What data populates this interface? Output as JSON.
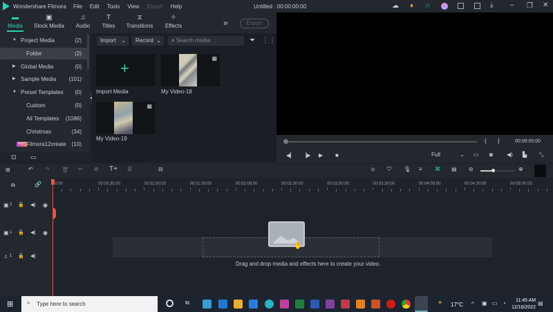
{
  "app": {
    "title": "Wondershare Filmora",
    "doc_title": "Untitled : 00:00:00:00",
    "menu": [
      "File",
      "Edit",
      "Tools",
      "View",
      "Export",
      "Help"
    ]
  },
  "tabs": [
    {
      "label": "Media",
      "icon": "folder-icon"
    },
    {
      "label": "Stock Media",
      "icon": "image-icon"
    },
    {
      "label": "Audio",
      "icon": "music-icon"
    },
    {
      "label": "Titles",
      "icon": "text-icon"
    },
    {
      "label": "Transitions",
      "icon": "transition-icon"
    },
    {
      "label": "Effects",
      "icon": "effects-icon"
    }
  ],
  "export_label": "Export",
  "sidebar": [
    {
      "label": "Project Media",
      "count": "(2)",
      "arrow": "▼"
    },
    {
      "label": "Folder",
      "count": "(2)",
      "arrow": ""
    },
    {
      "label": "Global Media",
      "count": "(0)",
      "arrow": "▶"
    },
    {
      "label": "Sample Media",
      "count": "(101)",
      "arrow": "▶"
    },
    {
      "label": "Preset Templates",
      "count": "(0)",
      "arrow": "▼"
    },
    {
      "label": "Custom",
      "count": "(0)",
      "arrow": ""
    },
    {
      "label": "All Templates",
      "count": "(1086)",
      "arrow": ""
    },
    {
      "label": "Christmas",
      "count": "(34)",
      "arrow": ""
    },
    {
      "label": "Filmora12create",
      "count": "(10)",
      "arrow": "",
      "badge": "HOT"
    }
  ],
  "media_toolbar": {
    "import": "Import",
    "record": "Record",
    "search_placeholder": "Search media"
  },
  "media_items": [
    {
      "label": "Import Media"
    },
    {
      "label": "My Video-18"
    },
    {
      "label": "My Video-19"
    }
  ],
  "preview": {
    "timecode": "00:00:00:00",
    "quality": "Full",
    "progress": 0
  },
  "ruler": [
    "00:00",
    "00:00:30:00",
    "00:01:00:00",
    "00:01:30:00",
    "00:02:00:00",
    "00:02:30:00",
    "00:03:00:00",
    "00:03:30:00",
    "00:04:00:00",
    "00:04:30:00",
    "00:05:00:00"
  ],
  "tracks": [
    {
      "num": "2",
      "type": "video"
    },
    {
      "num": "1",
      "type": "video"
    },
    {
      "num": "1",
      "type": "audio"
    }
  ],
  "drop_hint": "Drag and drop media and effects here to create your video.",
  "taskbar": {
    "search_placeholder": "Type here to search",
    "weather": "17°C",
    "time": "11:45 AM",
    "date": "12/16/2022"
  },
  "colors": {
    "accent": "#2ed0b0",
    "playhead": "#e8524a"
  }
}
